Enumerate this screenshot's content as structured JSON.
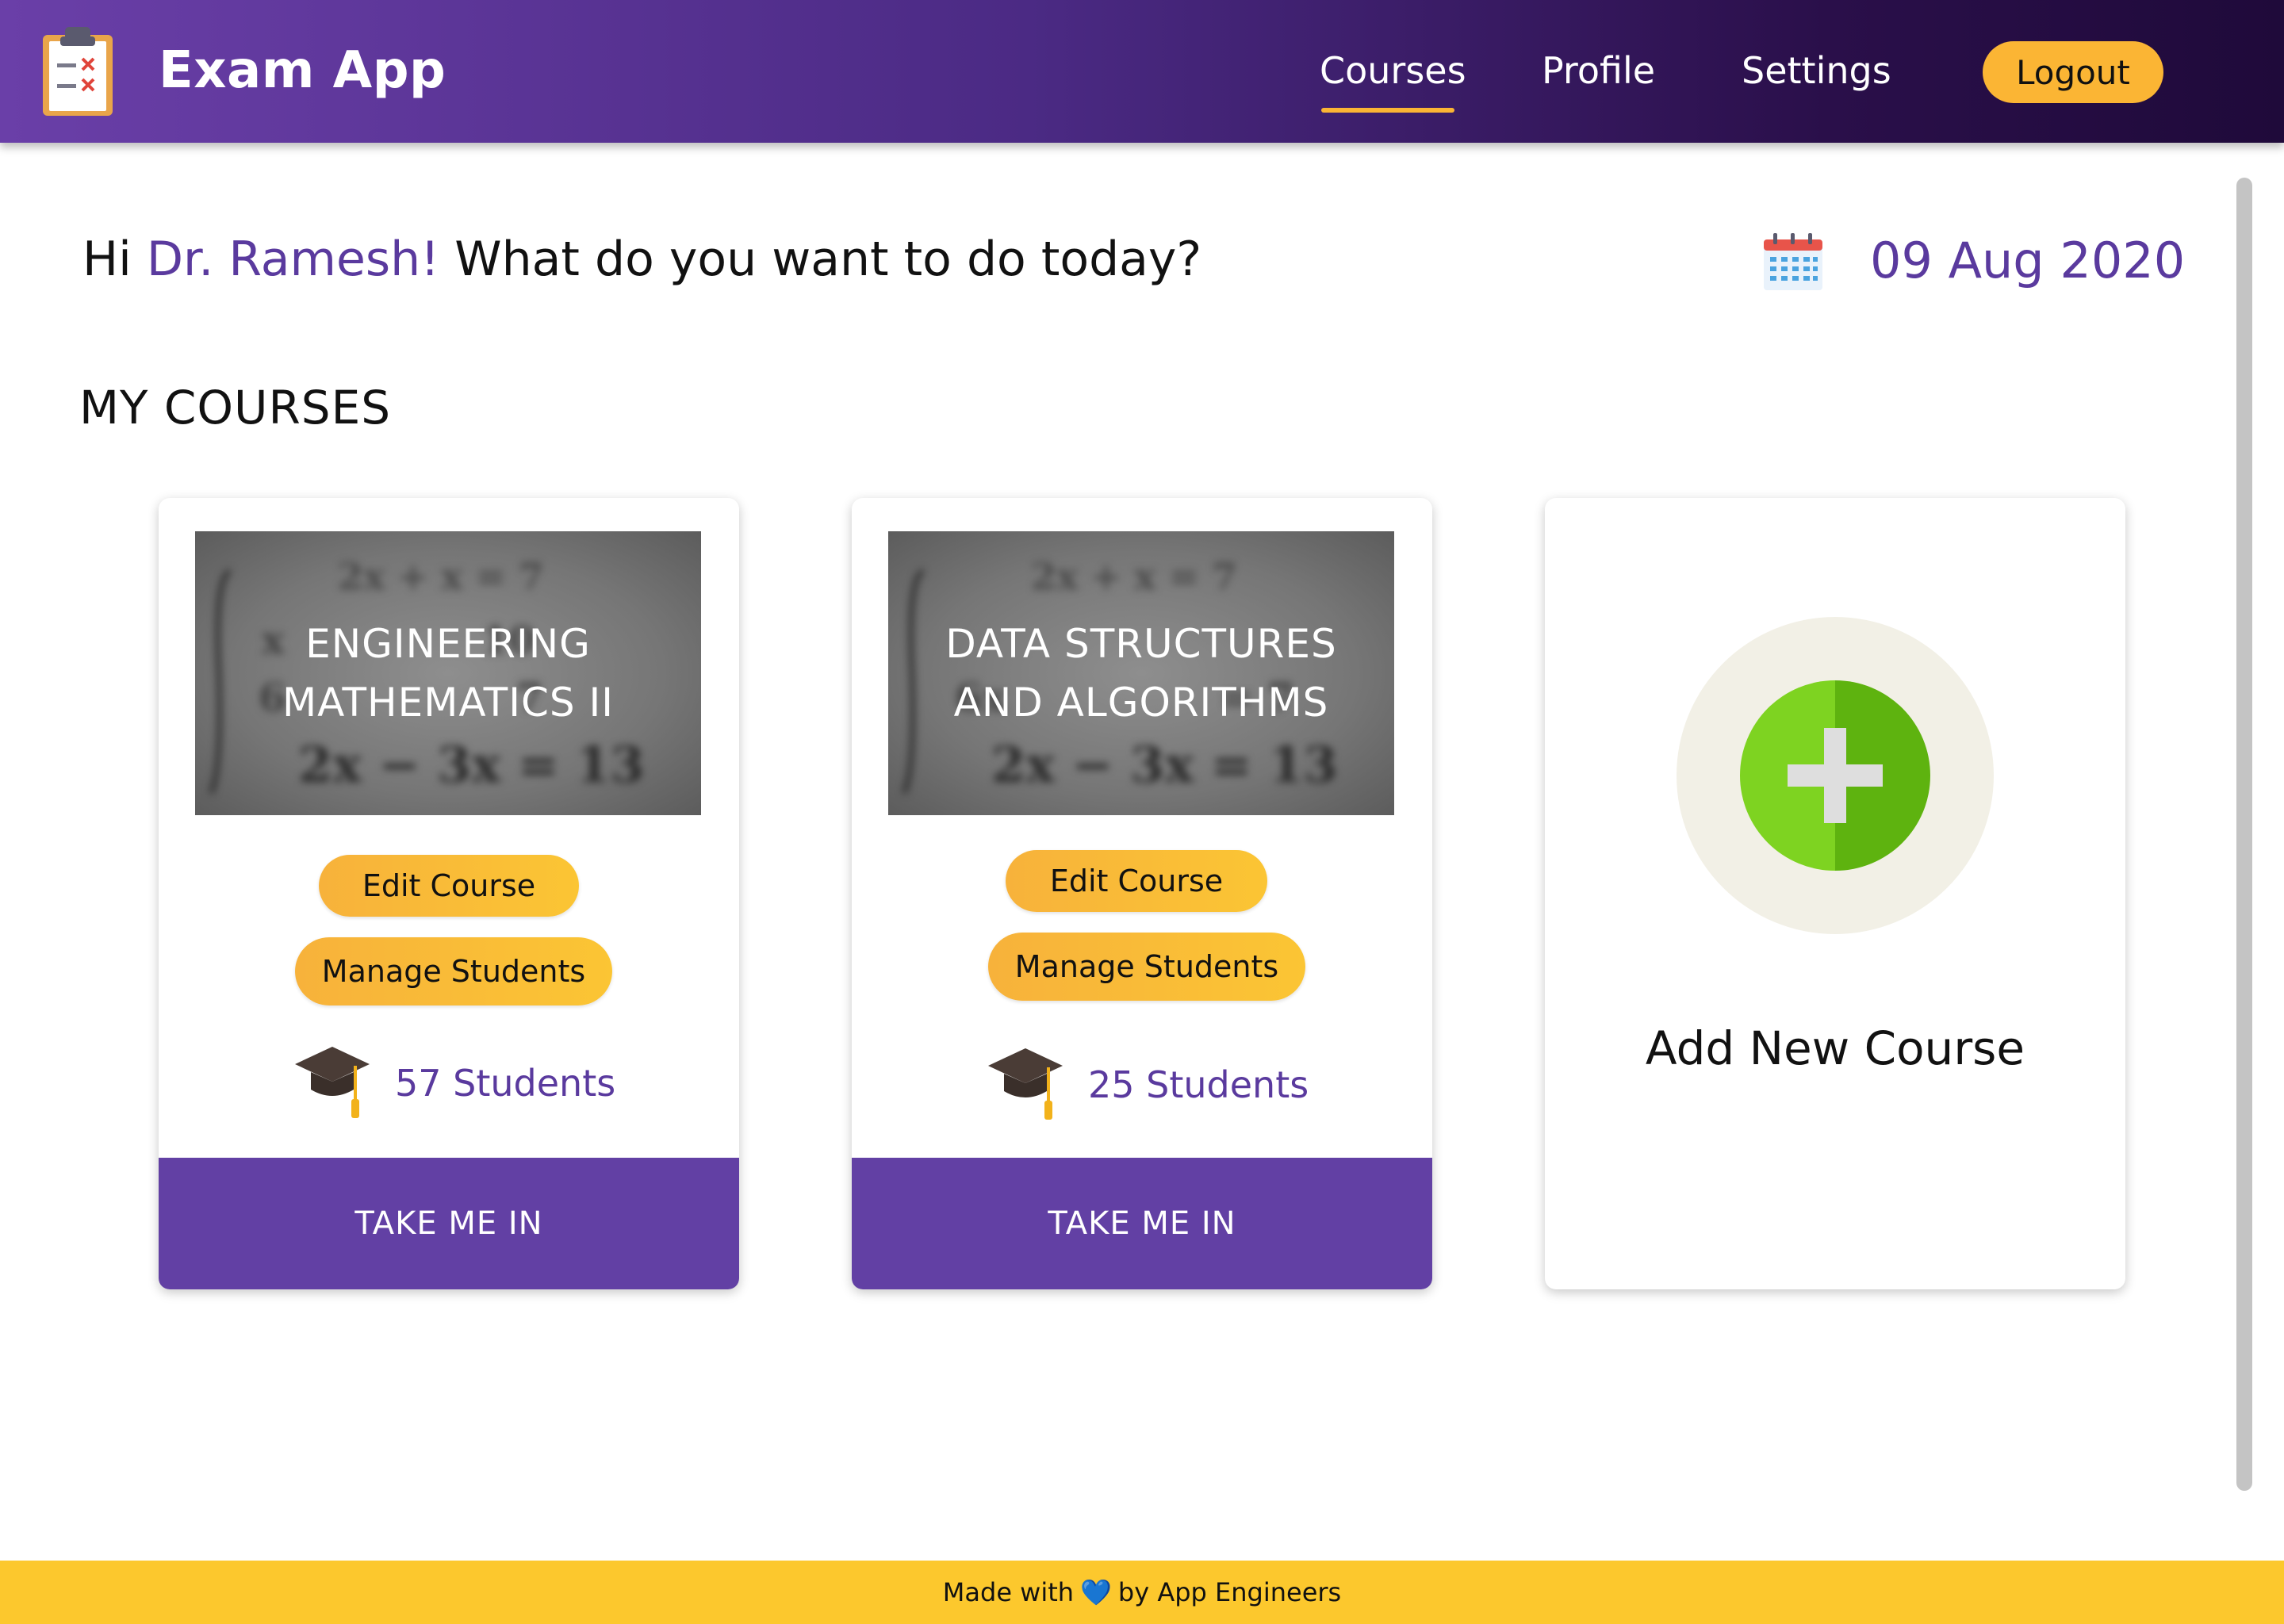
{
  "header": {
    "app_title": "Exam App",
    "nav": [
      {
        "label": "Courses",
        "active": true
      },
      {
        "label": "Profile",
        "active": false
      },
      {
        "label": "Settings",
        "active": false
      }
    ],
    "logout_label": "Logout",
    "logo_icon": "clipboard-checklist-icon"
  },
  "greeting": {
    "prefix": "Hi ",
    "name": "Dr. Ramesh!",
    "suffix": " What do you want to do today?"
  },
  "date": {
    "icon": "calendar-icon",
    "text": "09 Aug 2020"
  },
  "section_title": "MY COURSES",
  "courses": [
    {
      "title": "ENGINEERING MATHEMATICS II",
      "edit_label": "Edit Course",
      "manage_label": "Manage Students",
      "students_label": "57 Students",
      "take_label": "TAKE ME IN"
    },
    {
      "title": "DATA STRUCTURES AND ALGORITHMS",
      "edit_label": "Edit Course",
      "manage_label": "Manage Students",
      "students_label": "25 Students",
      "take_label": "TAKE ME IN"
    }
  ],
  "add_course": {
    "label": "Add New Course",
    "icon": "plus-circle-icon"
  },
  "footer": {
    "prefix": "Made with",
    "heart": "💙",
    "suffix": "by App Engineers"
  },
  "colors": {
    "header_start": "#6a3fa8",
    "header_end": "#1f0a3a",
    "accent": "#fbb534",
    "brand_purple": "#6240a4",
    "footer": "#fcc82d"
  }
}
